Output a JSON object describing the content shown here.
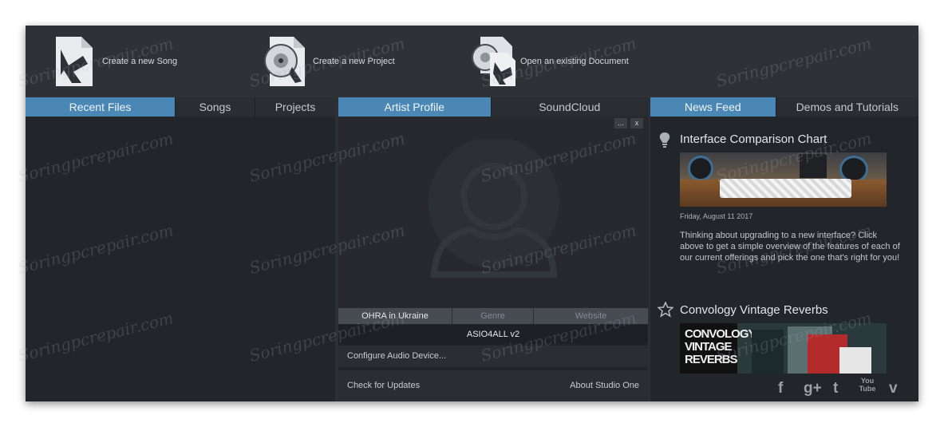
{
  "top_actions": {
    "new_song": "Create a new Song",
    "new_project": "Create a new Project",
    "open_document": "Open an existing Document"
  },
  "left_panel": {
    "tabs": [
      "Recent Files",
      "Songs",
      "Projects"
    ]
  },
  "middle_panel": {
    "tabs": [
      "Artist Profile",
      "SoundCloud"
    ],
    "mini_buttons": [
      "...",
      "x"
    ],
    "profile_fields": [
      "OHRA in Ukraine",
      "Genre",
      "Website"
    ],
    "audio_device": "ASIO4ALL v2",
    "configure_link": "Configure Audio Device...",
    "check_updates": "Check for Updates",
    "about": "About Studio One"
  },
  "right_panel": {
    "tabs": [
      "News Feed",
      "Demos and Tutorials"
    ],
    "news": [
      {
        "title": "Interface Comparison Chart",
        "date": "Friday, August 11 2017",
        "body": "Thinking about upgrading to a new interface? Click above to get a simple overview of the features of each of our current offerings and pick the one that's right for you!",
        "icon": "lightbulb-icon"
      },
      {
        "title": "Convology Vintage Reverbs",
        "image_text": [
          "CONVOLOGY",
          "VINTAGE",
          "REVERBS"
        ],
        "icon": "star-icon"
      }
    ],
    "social": [
      "f",
      "g+",
      "t",
      "You Tube",
      "v"
    ]
  },
  "watermark": "Soringpcrepair.com",
  "colors": {
    "accent": "#4a87b5",
    "panel": "#22252a",
    "frame": "#2c2f34"
  }
}
